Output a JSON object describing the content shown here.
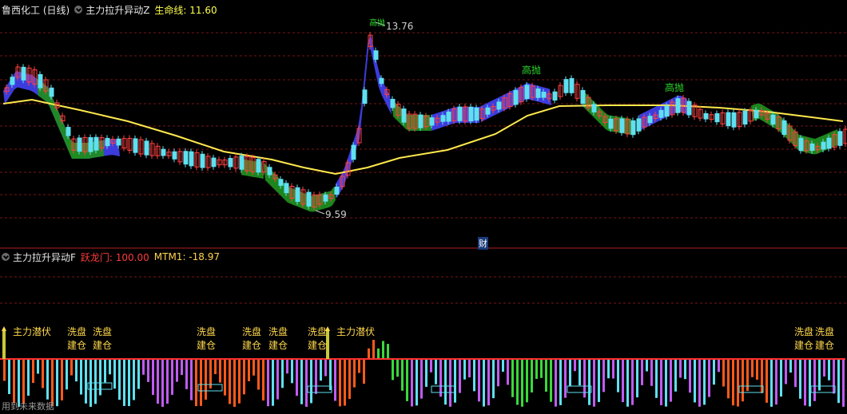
{
  "header_top": {
    "stock_name": "鲁西化工 (日线)",
    "indicator": "主力拉升异动Z",
    "life_line_label": "生命线: 11.60"
  },
  "header_bottom": {
    "indicator": "主力拉升异动F",
    "jump_gate_label": "跃龙门: 100.00",
    "mtm_label": "MTM1: -18.97"
  },
  "annotations": {
    "high_price": "13.76",
    "low_price": "9.59",
    "sell_high_1": "高抛",
    "sell_high_2": "高抛",
    "cai": "财",
    "top_mark": "高抛"
  },
  "signals": {
    "lurk": "主力潜伏",
    "wash": "洗盘",
    "build": "建仓"
  },
  "footer": "用到未来数据",
  "chart_data": {
    "type": "candlestick",
    "panels": [
      "price",
      "indicator"
    ],
    "price_extremes": {
      "high": 13.76,
      "low": 9.59
    },
    "life_line": 11.6,
    "jump_gate": 100.0,
    "mtm1": -18.97
  }
}
